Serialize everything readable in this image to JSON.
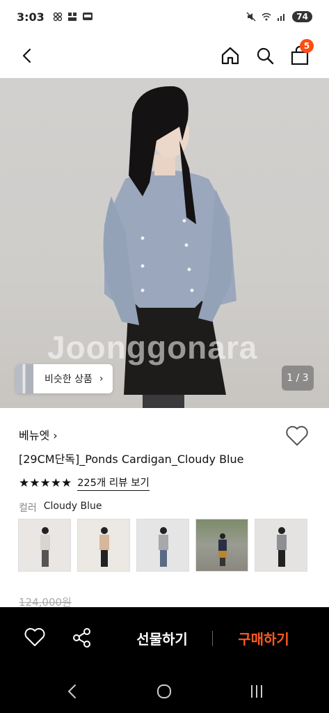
{
  "status_bar": {
    "time": "3:03",
    "battery": "74"
  },
  "nav": {
    "cart_count": "5"
  },
  "hero": {
    "watermark": "Joonggonara",
    "similar_label": "비슷한 상품",
    "pager": "1 / 3"
  },
  "product": {
    "brand": "베뉴엣",
    "title": "[29CM단독]_Ponds Cardigan_Cloudy Blue",
    "stars": "★★★★★",
    "review_link": "225개 리뷰 보기",
    "color_label": "컬러",
    "color_value": "Cloudy Blue",
    "original_price": "124,000원"
  },
  "colors": {
    "accent": "#ff5a1f",
    "badge": "#ff4d12",
    "bar_bg": "#000000"
  },
  "action_bar": {
    "gift_label": "선물하기",
    "buy_label": "구매하기"
  }
}
